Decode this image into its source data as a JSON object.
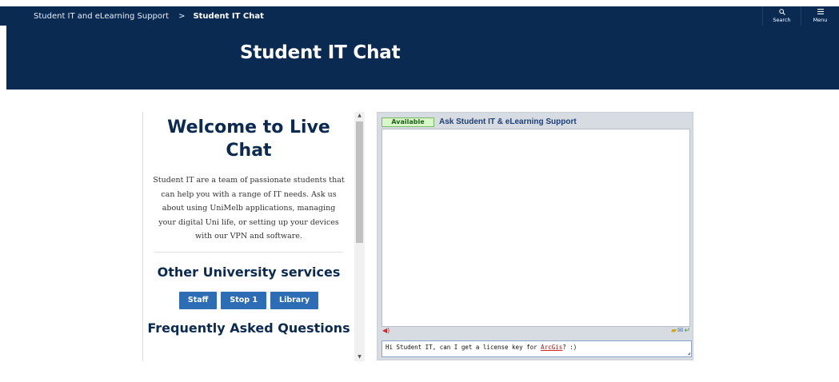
{
  "breadcrumb": {
    "parent": "Student IT and eLearning Support",
    "separator": ">",
    "current": "Student IT Chat"
  },
  "top_actions": {
    "search": {
      "label": "Search",
      "icon": "search-icon"
    },
    "menu": {
      "label": "Menu",
      "icon": "menu-icon"
    }
  },
  "hero": {
    "title": "Student IT Chat"
  },
  "left_panel": {
    "welcome_heading": "Welcome to Live Chat",
    "intro": "Student IT are a team of passionate students that can help you with a range of IT needs. Ask us about using UniMelb applications, managing your digital Uni life, or setting up your devices with our VPN and software.",
    "other_services_heading": "Other University services",
    "service_buttons": [
      "Staff",
      "Stop 1",
      "Library"
    ],
    "faq_heading": "Frequently Asked Questions"
  },
  "chat": {
    "status": "Available",
    "title": "Ask Student IT & eLearning Support",
    "input_value_before": "Hi Student IT, can I get a license key for ",
    "input_value_flagged": "ArcGis",
    "input_value_after": "? :)",
    "tool_icons": [
      "sound-icon",
      "file-transfer-icon",
      "email-transcript-icon",
      "end-chat-icon"
    ]
  },
  "colors": {
    "navy": "#0b2a52",
    "button_blue": "#2d6db5",
    "status_green_bg": "#d8f7c8",
    "chat_title_blue": "#1d3f76"
  }
}
